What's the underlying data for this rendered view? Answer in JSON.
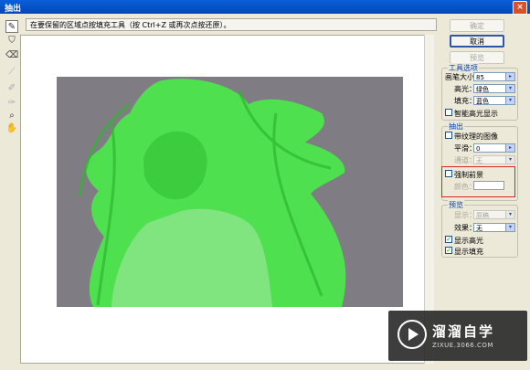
{
  "window": {
    "title": "抽出"
  },
  "hint": "在要保留的区域点按填充工具（按 Ctrl+Z 或再次点按还原）。",
  "buttons": {
    "ok": "确定",
    "cancel": "取消",
    "preview": "预览"
  },
  "tool_options": {
    "group_title": "工具选项",
    "brush_size_label": "画笔大小：",
    "brush_size_value": "85",
    "highlight_label": "高光：",
    "highlight_value": "绿色",
    "fill_label": "填充：",
    "fill_value": "蓝色",
    "smart_highlight_label": "智能高光显示"
  },
  "extraction": {
    "group_title": "抽出",
    "textured_label": "带纹理的图像",
    "smooth_label": "平滑：",
    "smooth_value": "0",
    "channel_label": "通道：",
    "channel_value": "无",
    "force_fg_label": "强制前景",
    "color_label": "颜色："
  },
  "preview": {
    "group_title": "预览",
    "show_label": "显示：",
    "show_value": "原稿",
    "effect_label": "效果：",
    "effect_value": "无",
    "show_highlight_label": "显示高光",
    "show_fill_label": "显示填充"
  },
  "watermark": {
    "brand": "溜溜自学",
    "url": "ZIXUE.3066.COM"
  },
  "colors": {
    "highlight_green": "#3fdc3f",
    "backdrop_gray": "#8a8890",
    "selection_red": "#dd2222"
  },
  "icons": [
    "edge-highlighter-icon",
    "fill-icon",
    "eraser-icon",
    "eyedropper-icon",
    "cleanup-icon",
    "edge-touchup-icon",
    "zoom-icon",
    "hand-icon"
  ]
}
